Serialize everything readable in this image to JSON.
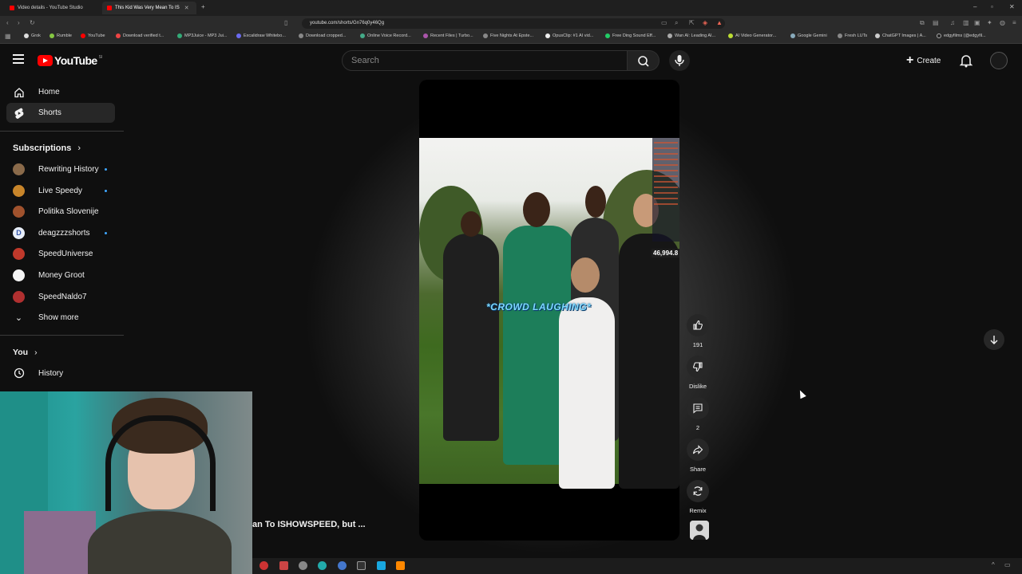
{
  "browser": {
    "tabs": [
      {
        "label": "Video details - YouTube Studio",
        "active": false
      },
      {
        "label": "This Kid Was Very Mean To IS",
        "active": true
      }
    ],
    "url": "youtube.com/shorts/Gn76q0y46Qg",
    "bookmarks": [
      "Grok",
      "Rumble",
      "YouTube",
      "Download verified t...",
      "MP3Juice - MP3 Jui...",
      "Excalidraw Whitebo...",
      "Download cropped...",
      "Online Voice Record...",
      "Recent Files | Turbo...",
      "Five Nights At Epste...",
      "OpusClip: #1 AI vid...",
      "Free Ding Sound Eff...",
      "Wan AI: Leading AI...",
      "AI Video Generator...",
      "Google Gemini",
      "Fresh LUTs",
      "ChatGPT Images | A...",
      "edgyfilms (@edgyfil..."
    ]
  },
  "header": {
    "logo_text": "YouTube",
    "logo_region": "SI",
    "search_placeholder": "Search",
    "create_label": "Create"
  },
  "sidebar": {
    "nav": [
      {
        "label": "Home",
        "icon": "home-icon"
      },
      {
        "label": "Shorts",
        "icon": "shorts-icon",
        "active": true
      }
    ],
    "subscriptions_heading": "Subscriptions",
    "subscriptions": [
      {
        "name": "Rewriting History",
        "live": true,
        "color": "#8a6a4a"
      },
      {
        "name": "Live Speedy",
        "live": true,
        "color": "#c8852a"
      },
      {
        "name": "Politika Slovenije",
        "live": false,
        "color": "#a0522d"
      },
      {
        "name": "deagzzzshorts",
        "live": true,
        "color": "#e8eef8"
      },
      {
        "name": "SpeedUniverse",
        "live": false,
        "color": "#c0392b"
      },
      {
        "name": "Money Groot",
        "live": false,
        "color": "#f5f5f5"
      },
      {
        "name": "SpeedNaldo7",
        "live": false,
        "color": "#b03030"
      }
    ],
    "show_more": "Show more",
    "you_heading": "You",
    "history": "History"
  },
  "short": {
    "caption": "*CROWD LAUGHING*",
    "viewer_count": "46,994.8",
    "title": "an To ISHOWSPEED,  but ...",
    "like_count": "191",
    "dislike_label": "Dislike",
    "comment_count": "2",
    "share_label": "Share",
    "remix_label": "Remix"
  },
  "colors": {
    "background": "#0f0f0f",
    "brand_red": "#ff0000",
    "live_dot": "#3ea6ff",
    "caption": "#7ed8ff"
  }
}
